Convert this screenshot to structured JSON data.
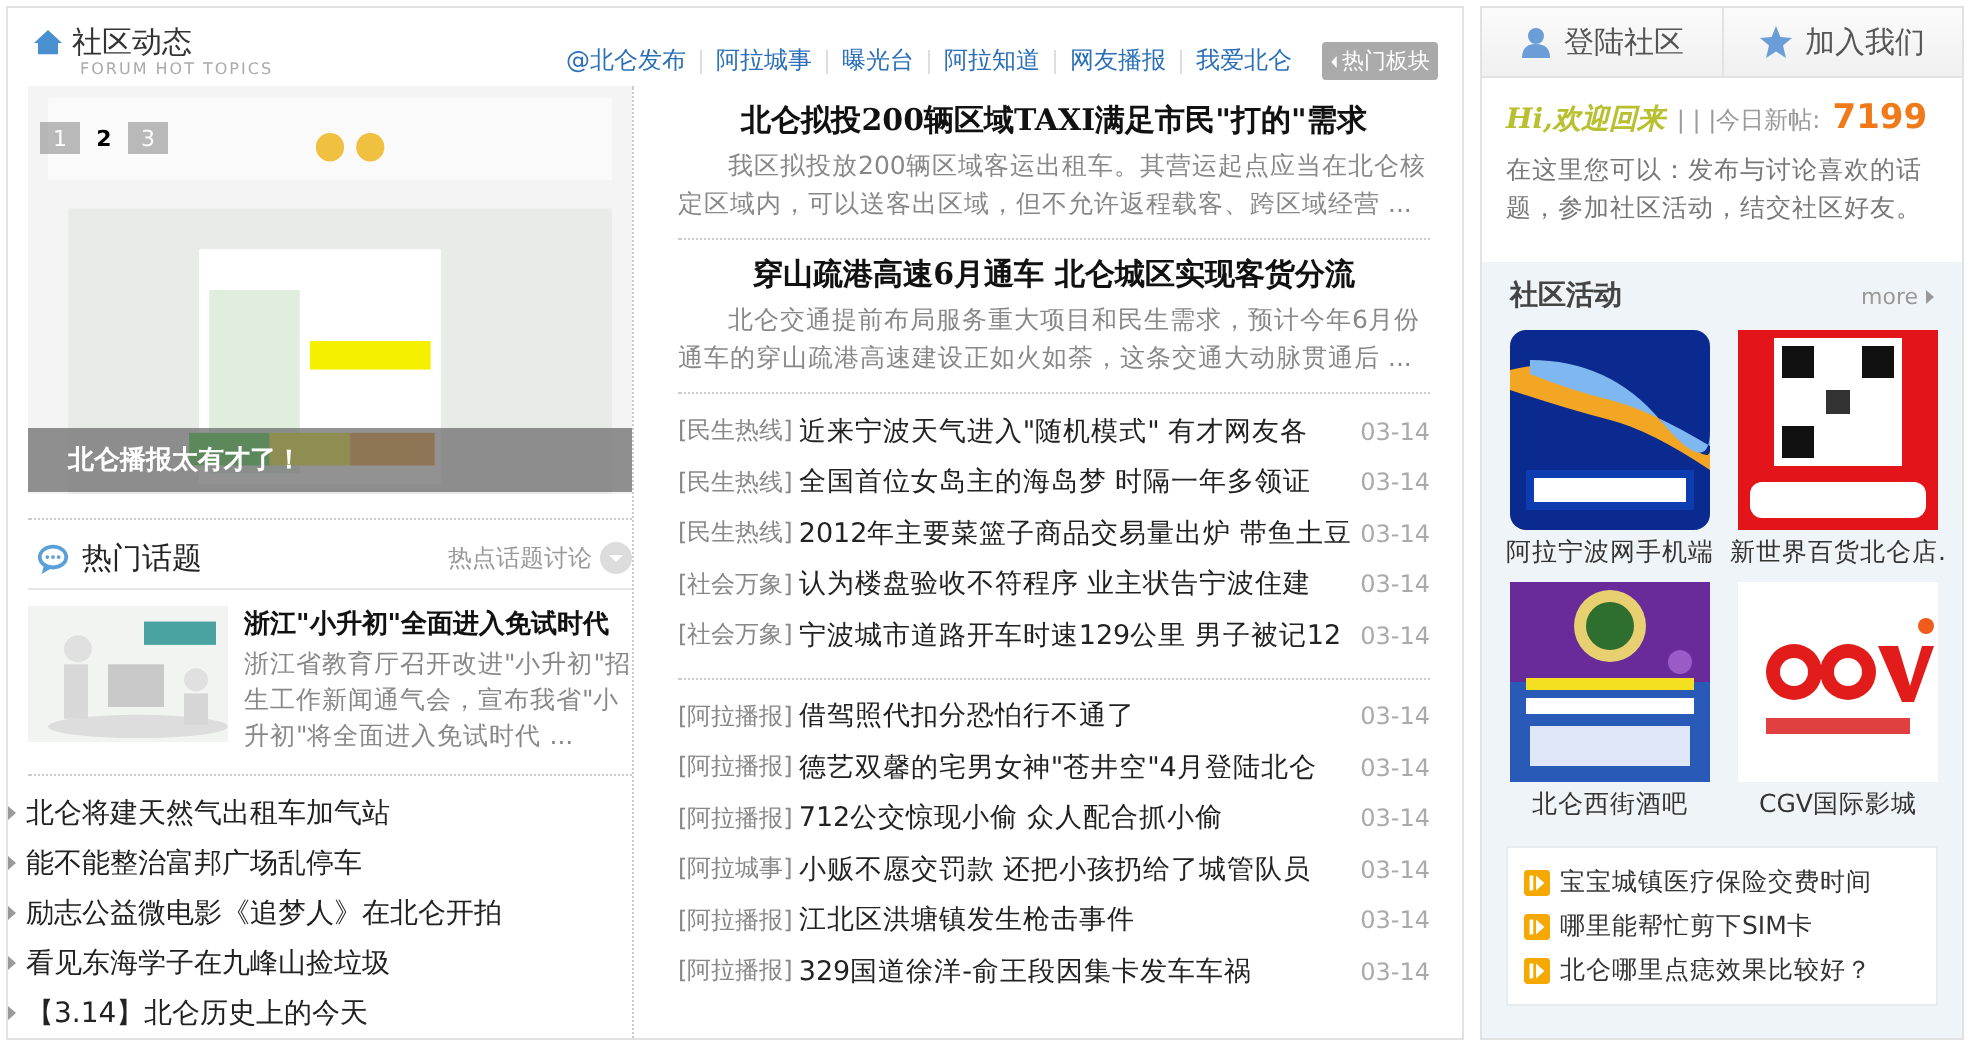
{
  "header": {
    "title": "社区动态",
    "subtitle": "FORUM HOT TOPICS",
    "links": [
      "@北仑发布",
      "阿拉城事",
      "曝光台",
      "阿拉知道",
      "网友播报",
      "我爱北仑"
    ],
    "hot_button": "热门板块"
  },
  "slideshow": {
    "kind": "picture",
    "slides": [
      {
        "label": "1",
        "selected": false
      },
      {
        "label": "2",
        "selected": true
      },
      {
        "label": "3",
        "selected": false
      }
    ],
    "caption": "北仑播报太有才了！"
  },
  "hot_topics": {
    "title": "热门话题",
    "more": "热点话题讨论",
    "feature": {
      "title": "浙江\"小升初\"全面进入免试时代",
      "summary": "浙江省教育厅召开改进\"小升初\"招生工作新闻通气会，宣布我省\"小升初\"将全面进入免试时代 ..."
    },
    "links": [
      "北仑将建天然气出租车加气站",
      "能不能整治富邦广场乱停车",
      "励志公益微电影《追梦人》在北仑开拍",
      "看见东海学子在九峰山捡垃圾",
      "【3.14】北仑历史上的今天"
    ]
  },
  "headlines": [
    {
      "title": "北仑拟投200辆区域TAXI满足市民\"打的\"需求",
      "summary": "我区拟投放200辆区域客运出租车。其营运起点应当在北仑核定区域内，可以送客出区域，但不允许返程载客、跨区域经营 ..."
    },
    {
      "title": "穿山疏港高速6月通车 北仑城区实现客货分流",
      "summary": "北仑交通提前布局服务重大项目和民生需求，预计今年6月份通车的穿山疏港高速建设正如火如荼，这条交通大动脉贯通后 ..."
    }
  ],
  "news_groups": [
    {
      "items": [
        {
          "category": "[民生热线]",
          "title": "近来宁波天气进入\"随机模式\" 有才网友各",
          "date": "03-14"
        },
        {
          "category": "[民生热线]",
          "title": "全国首位女岛主的海岛梦 时隔一年多领证",
          "date": "03-14"
        },
        {
          "category": "[民生热线]",
          "title": "2012年主要菜篮子商品交易量出炉 带鱼土豆",
          "date": "03-14"
        },
        {
          "category": "[社会万象]",
          "title": "认为楼盘验收不符程序 业主状告宁波住建",
          "date": "03-14"
        },
        {
          "category": "[社会万象]",
          "title": "宁波城市道路开车时速129公里 男子被记12",
          "date": "03-14"
        }
      ]
    },
    {
      "items": [
        {
          "category": "[阿拉播报]",
          "title": "借驾照代扣分恐怕行不通了",
          "date": "03-14"
        },
        {
          "category": "[阿拉播报]",
          "title": "德艺双馨的宅男女神\"苍井空\"4月登陆北仑",
          "date": "03-14"
        },
        {
          "category": "[阿拉播报]",
          "title": "712公交惊现小偷 众人配合抓小偷",
          "date": "03-14"
        },
        {
          "category": "[阿拉城事]",
          "title": "小贩不愿交罚款 还把小孩扔给了城管队员",
          "date": "03-14"
        },
        {
          "category": "[阿拉播报]",
          "title": "江北区洪塘镇发生枪击事件",
          "date": "03-14"
        },
        {
          "category": "[阿拉播报]",
          "title": "329国道徐洋-俞王段因集卡发车车祸",
          "date": "03-14"
        }
      ]
    }
  ],
  "sidebar": {
    "tabs": [
      {
        "label": "登陆社区",
        "kind": "person"
      },
      {
        "label": "加入我们",
        "kind": "star"
      }
    ],
    "greeting": "Hi,欢迎回来",
    "new_posts_label": "| | |今日新帖:",
    "new_posts_count": "7199",
    "intro": "在这里您可以：发布与讨论喜欢的话题，参加社区活动，结交社区好友。",
    "activities": {
      "title": "社区活动",
      "more": "more",
      "items": [
        {
          "caption": "阿拉宁波网手机端",
          "kind": "waves"
        },
        {
          "caption": "新世界百货北仑店.",
          "kind": "code"
        },
        {
          "caption": "北仑西街酒吧",
          "kind": "bar"
        },
        {
          "caption": "CGV国际影城",
          "kind": "cinema"
        }
      ]
    },
    "questions": [
      "宝宝城镇医疗保险交费时间",
      "哪里能帮忙剪下SIM卡",
      "北仑哪里点痣效果比较好？"
    ]
  }
}
